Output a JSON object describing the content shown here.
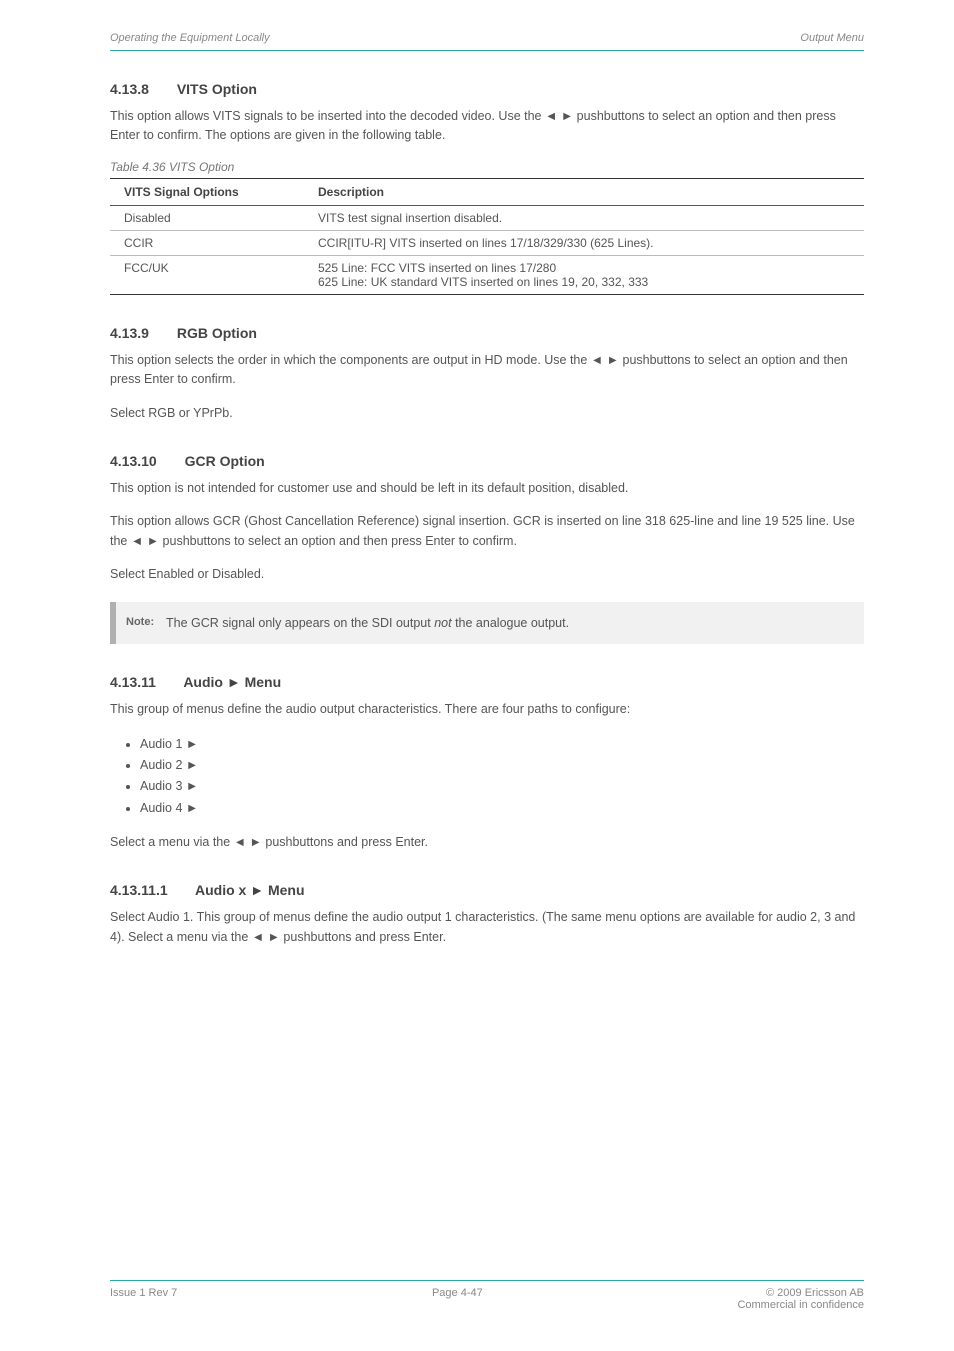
{
  "header": {
    "left": "Operating the Equipment Locally",
    "right": "Output Menu"
  },
  "sec1": {
    "number": "4.13.8",
    "title": "VITS Option",
    "para": "This option allows VITS signals to be inserted into the decoded video. Use the ◄ ► pushbuttons to select an option and then press Enter to confirm. The options are given in the following table.",
    "tableTitle": "Table 4.36 VITS Option",
    "th1": "VITS Signal Options",
    "th2": "Description",
    "rows": [
      {
        "opt": "Disabled",
        "desc": "VITS test signal insertion disabled."
      },
      {
        "opt": "CCIR",
        "desc": "CCIR[ITU-R] VITS inserted on lines 17/18/329/330 (625 Lines)."
      },
      {
        "opt": "FCC/UK",
        "desc": "525 Line:  FCC VITS inserted on lines 17/280\n625 Line: UK standard VITS inserted on lines 19, 20, 332, 333"
      }
    ]
  },
  "sec2": {
    "number": "4.13.9",
    "title": "RGB Option",
    "para1": "This option selects the order in which the components are output in HD mode. Use the ◄ ► pushbuttons to select an option and then press Enter to confirm.",
    "para2": "Select RGB or YPrPb."
  },
  "sec3": {
    "number": "4.13.10",
    "title": "GCR Option",
    "para1": "This option is not intended for customer use and should be left in its default position, disabled.",
    "para2": "This option allows GCR (Ghost Cancellation Reference) signal insertion. GCR is inserted on line 318 625-line and line 19 525 line. Use the ◄ ► pushbuttons to select an option and then press Enter to confirm.",
    "para3": "Select Enabled or Disabled.",
    "note": "The GCR signal only appears on the SDI output ",
    "noteItalic": "not",
    "noteTail": " the analogue output.",
    "noteLabel": "Note:"
  },
  "sec4": {
    "number": "4.13.11",
    "title": "Audio ► Menu",
    "para": "This group of menus define the audio output characteristics. There are four paths to configure:",
    "paths": [
      "Audio 1 ►",
      "Audio 2 ►",
      "Audio 3 ►",
      "Audio 4 ►"
    ],
    "tail": "Select a menu via the ◄ ► pushbuttons and press Enter."
  },
  "sec5": {
    "number": "4.13.11.1",
    "title": "Audio x ► Menu",
    "para": "Select Audio 1. This group of menus define the audio output 1 characteristics. (The same menu options are available for audio 2, 3 and 4). Select a menu via the ◄ ► pushbuttons and press Enter."
  },
  "footer": {
    "left": "Issue 1 Rev 7",
    "center": "Page 4-47",
    "right": "© 2009 Ericsson AB\nCommercial in confidence"
  }
}
